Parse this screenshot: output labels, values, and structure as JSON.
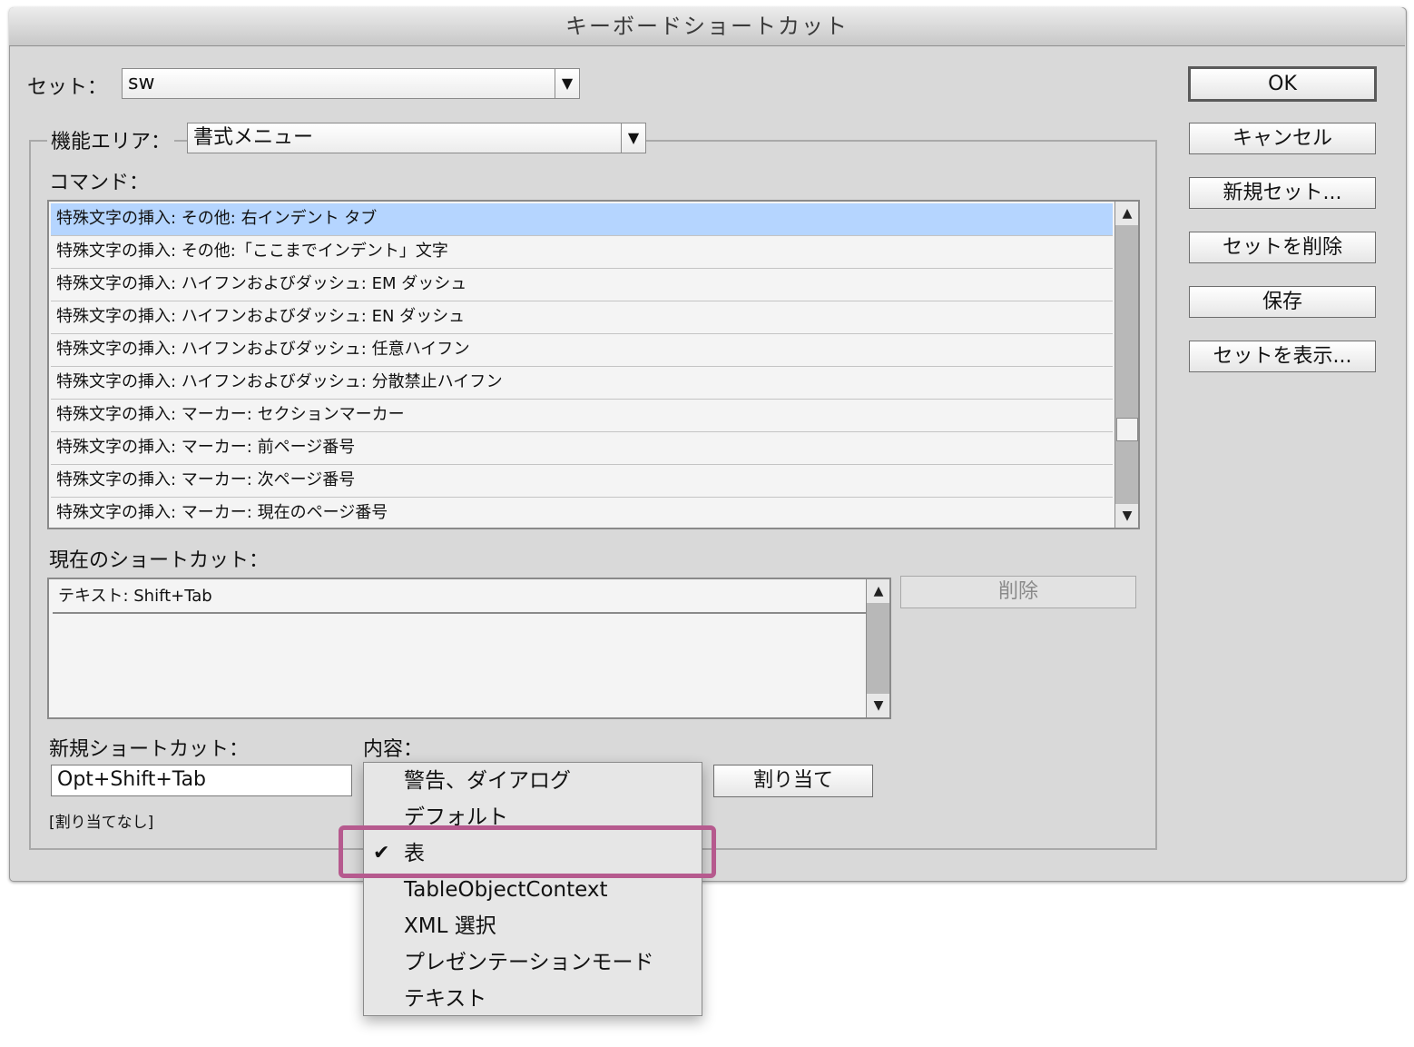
{
  "window": {
    "title": "キーボードショートカット"
  },
  "set": {
    "label": "セット：",
    "value": "sw"
  },
  "buttons": {
    "ok": "OK",
    "cancel": "キャンセル",
    "new_set": "新規セット...",
    "delete_set": "セットを削除",
    "save": "保存",
    "show_set": "セットを表示...",
    "remove": "削除",
    "assign": "割り当て"
  },
  "function_area": {
    "label": "機能エリア：",
    "value": "書式メニュー"
  },
  "commands": {
    "label": "コマンド：",
    "selected_index": 0,
    "items": [
      "特殊文字の挿入: その他: 右インデント タブ",
      "特殊文字の挿入: その他:「ここまでインデント」文字",
      "特殊文字の挿入: ハイフンおよびダッシュ: EM ダッシュ",
      "特殊文字の挿入: ハイフンおよびダッシュ: EN ダッシュ",
      "特殊文字の挿入: ハイフンおよびダッシュ: 任意ハイフン",
      "特殊文字の挿入: ハイフンおよびダッシュ: 分散禁止ハイフン",
      "特殊文字の挿入: マーカー: セクションマーカー",
      "特殊文字の挿入: マーカー: 前ページ番号",
      "特殊文字の挿入: マーカー: 次ページ番号",
      "特殊文字の挿入: マーカー: 現在のページ番号"
    ]
  },
  "current_shortcuts": {
    "label": "現在のショートカット：",
    "items": [
      "テキスト: Shift+Tab"
    ]
  },
  "new_shortcut": {
    "label": "新規ショートカット：",
    "value": "Opt+Shift+Tab",
    "status": "[割り当てなし]"
  },
  "context": {
    "label": "内容：",
    "selected": "表",
    "options": [
      "警告、ダイアログ",
      "デフォルト",
      "表",
      "TableObjectContext",
      "XML 選択",
      "プレゼンテーションモード",
      "テキスト"
    ]
  },
  "icons": {
    "dropdown": "triangle-down-icon",
    "scroll_up": "scroll-up-icon",
    "scroll_down": "scroll-down-icon",
    "checkmark": "checkmark-icon"
  },
  "colors": {
    "selection": "#b5d5ff",
    "annotation": "#b65a8e",
    "dialog_bg": "#d9d9d9"
  }
}
